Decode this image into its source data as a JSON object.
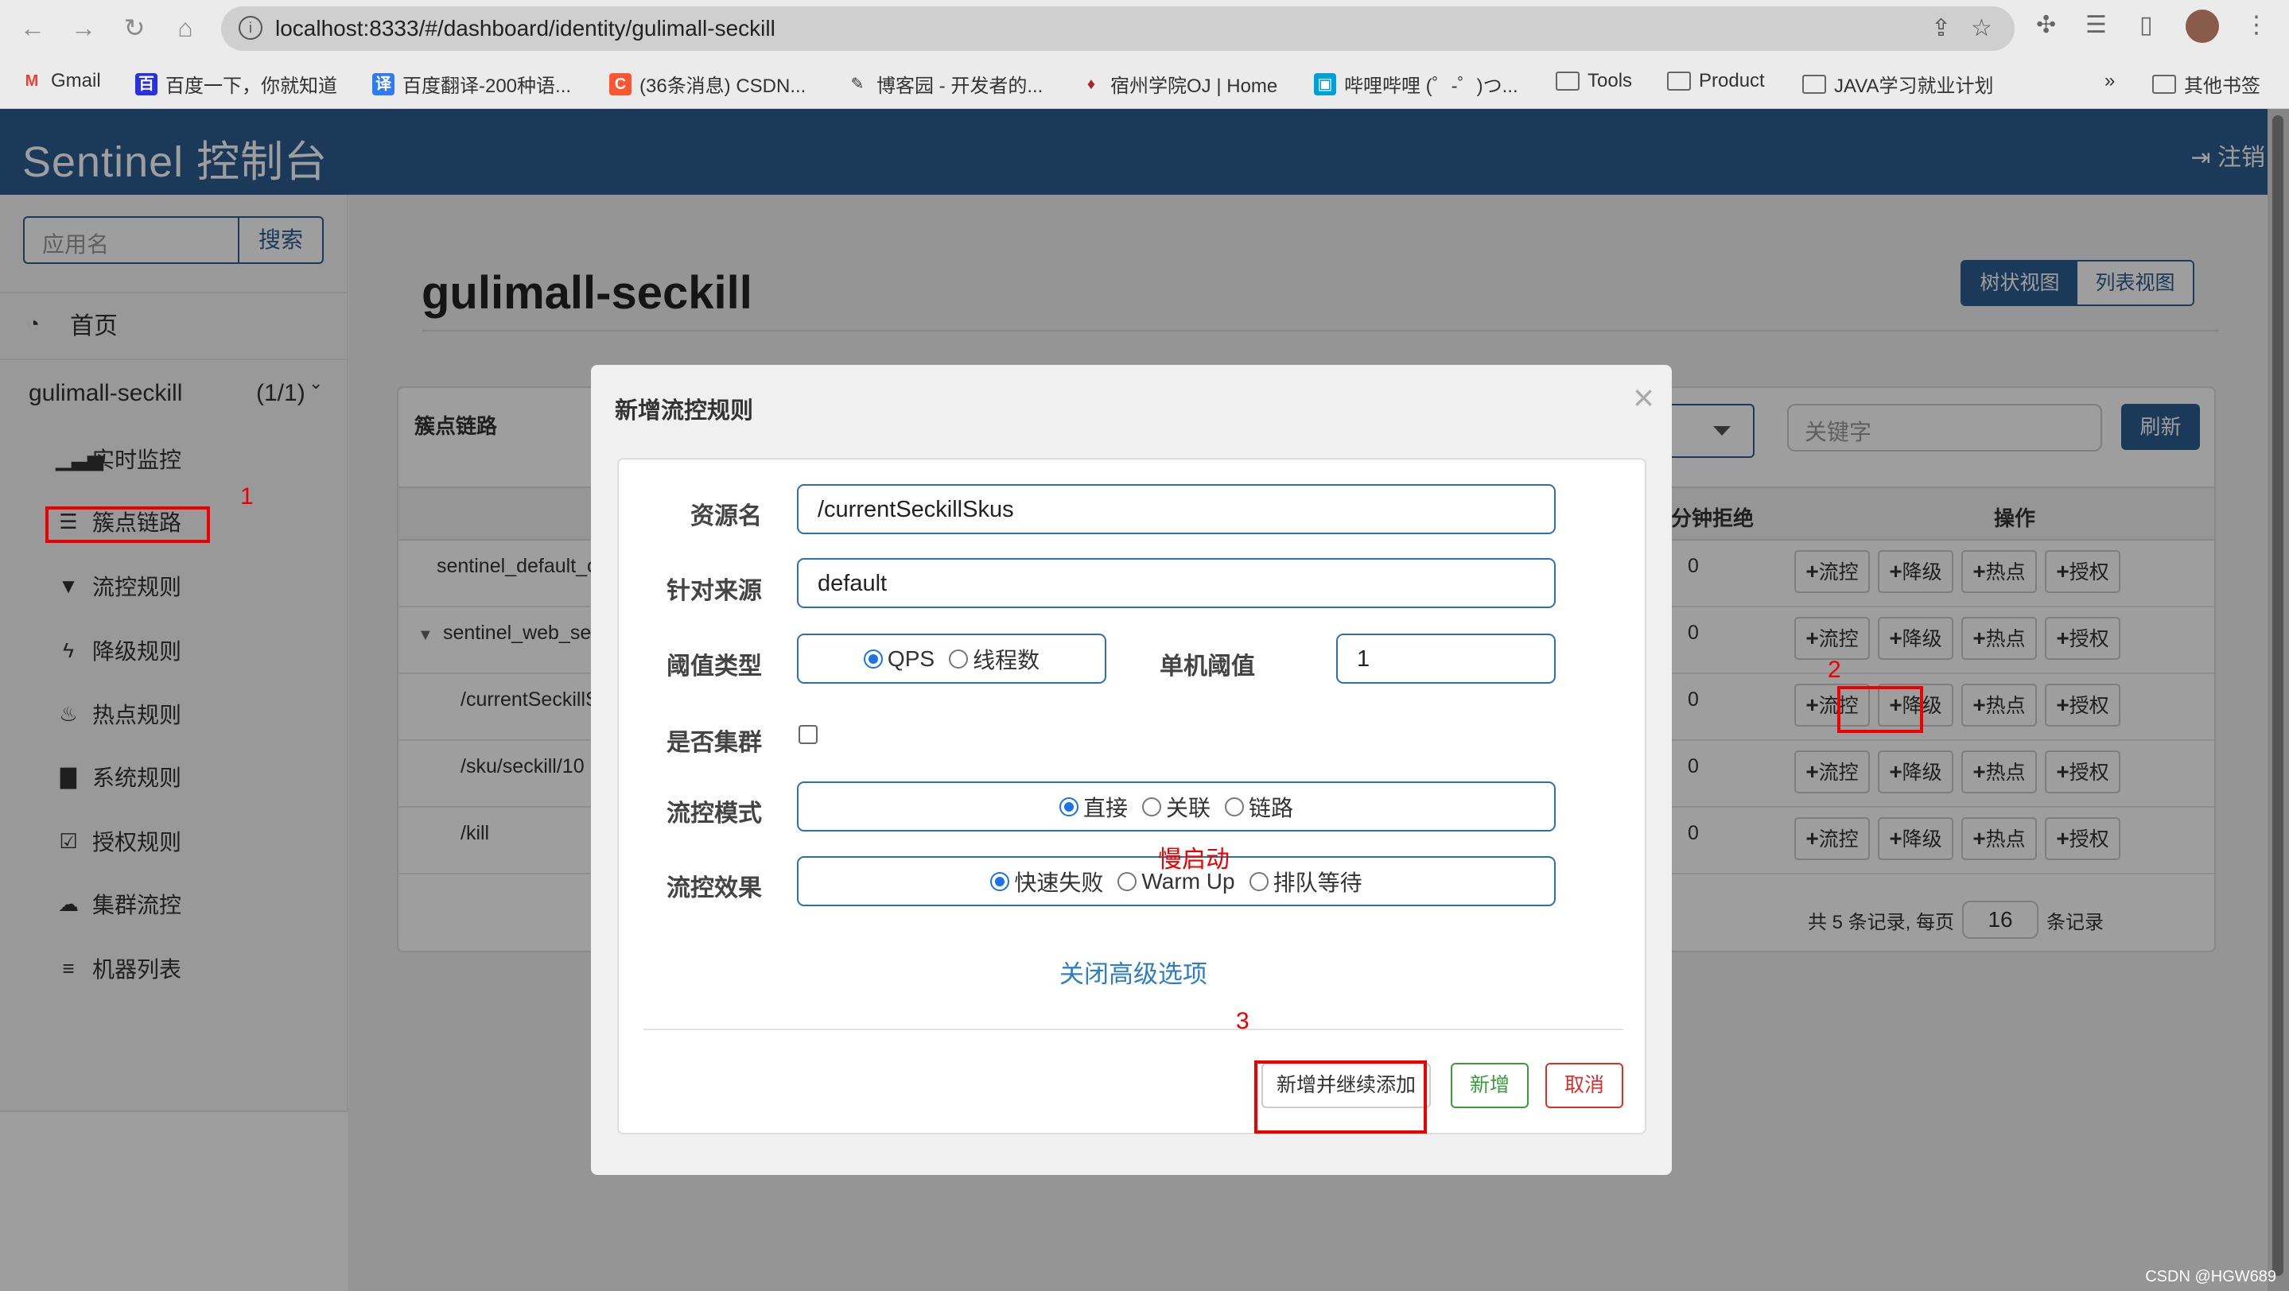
{
  "browser": {
    "url": "localhost:8333/#/dashboard/identity/gulimall-seckill",
    "bookmarks": [
      {
        "label": "Gmail",
        "icon": "gmail-icon",
        "color": "#ea4335"
      },
      {
        "label": "百度一下，你就知道",
        "icon": "baidu-icon",
        "color": "#2932e1"
      },
      {
        "label": "百度翻译-200种语...",
        "icon": "translate-icon",
        "color": "#2f7bf5"
      },
      {
        "label": "(36条消息) CSDN...",
        "icon": "csdn-icon",
        "color": "#fc5531"
      },
      {
        "label": "博客园 - 开发者的...",
        "icon": "cnblogs-icon",
        "color": "#333333"
      },
      {
        "label": "宿州学院OJ | Home",
        "icon": "oj-icon",
        "color": "#b22222"
      },
      {
        "label": "哔哩哔哩 (゜-゜)つ...",
        "icon": "bilibili-icon",
        "color": "#00a1d6"
      },
      {
        "label": "Tools",
        "icon": "folder-icon"
      },
      {
        "label": "Product",
        "icon": "folder-icon"
      },
      {
        "label": "JAVA学习就业计划",
        "icon": "folder-icon"
      }
    ],
    "more": "»",
    "other_bookmarks": "其他书签"
  },
  "header": {
    "brand": "Sentinel 控制台",
    "logout": "注销"
  },
  "sidebar": {
    "search_placeholder": "应用名",
    "search_button": "搜索",
    "home": "首页",
    "app_name": "gulimall-seckill",
    "app_count": "(1/1)",
    "items": [
      {
        "label": "实时监控",
        "icon": "bar-chart-icon"
      },
      {
        "label": "簇点链路",
        "icon": "list-icon"
      },
      {
        "label": "流控规则",
        "icon": "filter-icon"
      },
      {
        "label": "降级规则",
        "icon": "bolt-icon"
      },
      {
        "label": "热点规则",
        "icon": "fire-icon"
      },
      {
        "label": "系统规则",
        "icon": "lock-icon"
      },
      {
        "label": "授权规则",
        "icon": "check-circle-icon"
      },
      {
        "label": "集群流控",
        "icon": "cloud-icon"
      },
      {
        "label": "机器列表",
        "icon": "list-bullets-icon"
      }
    ]
  },
  "main": {
    "title": "gulimall-seckill",
    "view_tree": "树状视图",
    "view_list": "列表视图",
    "panel_title": "簇点链路",
    "keyword_placeholder": "关键字",
    "refresh": "刷新",
    "columns": {
      "reject": "分钟拒绝",
      "ops": "操作"
    },
    "rows": [
      {
        "resource": "sentinel_default_c",
        "reject": "0",
        "expand": false
      },
      {
        "resource": "sentinel_web_ser",
        "reject": "0",
        "expand": true
      },
      {
        "resource": "/currentSeckillS",
        "reject": "0",
        "expand": false
      },
      {
        "resource": "/sku/seckill/10",
        "reject": "0",
        "expand": false
      },
      {
        "resource": "/kill",
        "reject": "0",
        "expand": false
      }
    ],
    "op_buttons": [
      "流控",
      "降级",
      "热点",
      "授权"
    ],
    "pager": {
      "prefix": "共 5 条记录, 每页",
      "page_size": "16",
      "suffix": "条记录"
    }
  },
  "modal": {
    "title": "新增流控规则",
    "fields": {
      "resource_label": "资源名",
      "resource_value": "/currentSeckillSkus",
      "origin_label": "针对来源",
      "origin_value": "default",
      "threshold_type_label": "阈值类型",
      "threshold_type_options": [
        "QPS",
        "线程数"
      ],
      "threshold_type_selected": "QPS",
      "threshold_label": "单机阈值",
      "threshold_value": "1",
      "cluster_label": "是否集群",
      "cluster_checked": false,
      "mode_label": "流控模式",
      "mode_options": [
        "直接",
        "关联",
        "链路"
      ],
      "mode_selected": "直接",
      "effect_label": "流控效果",
      "effect_options": [
        "快速失败",
        "Warm Up",
        "排队等待"
      ],
      "effect_selected": "快速失败"
    },
    "advanced_link": "关闭高级选项",
    "buttons": {
      "add_continue": "新增并继续添加",
      "add": "新增",
      "cancel": "取消"
    }
  },
  "annotations": {
    "one": "1",
    "two": "2",
    "three": "3",
    "warmup_note": "慢启动"
  },
  "watermark": "CSDN @HGW689",
  "colors": {
    "header": "#2c5d8e",
    "link": "#2f7ec2",
    "annotation": "#ee0000",
    "add_green": "#3a9d3a",
    "cancel_red": "#d9302c"
  }
}
